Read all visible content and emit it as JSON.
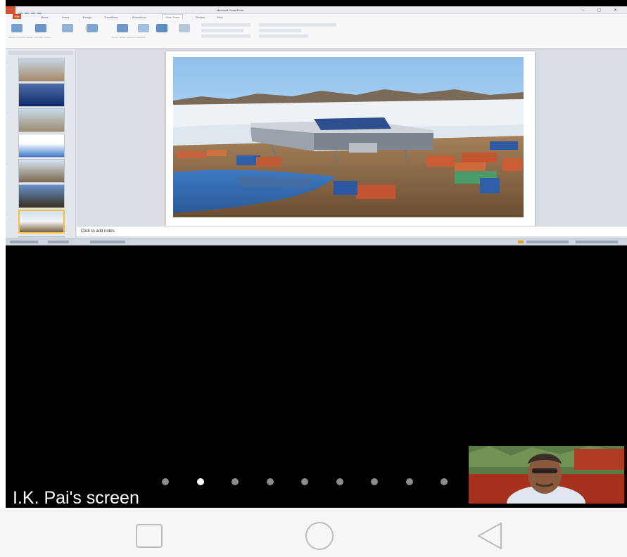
{
  "ppt": {
    "doc_title": "Microsoft PowerPoint",
    "tabs": [
      {
        "label": "File"
      },
      {
        "label": "Home"
      },
      {
        "label": "Insert"
      },
      {
        "label": "Design"
      },
      {
        "label": "Transitions"
      },
      {
        "label": "Animations"
      },
      {
        "label": "Slide Show"
      },
      {
        "label": "Review"
      },
      {
        "label": "View"
      }
    ],
    "active_tab_index": 6,
    "notes_placeholder": "Click to add notes",
    "selected_slide_index": 6
  },
  "share": {
    "screen_label": "I.K. Pai's screen",
    "page_count": 10,
    "active_page_index": 1
  },
  "colors": {
    "file_tab": "#d35230",
    "video_bg": "#000000",
    "active_dot": "#ffffff",
    "inactive_dot": "#8c8c8c"
  },
  "nav": {
    "recents_icon": "square-icon",
    "home_icon": "circle-icon",
    "back_icon": "triangle-back-icon"
  }
}
